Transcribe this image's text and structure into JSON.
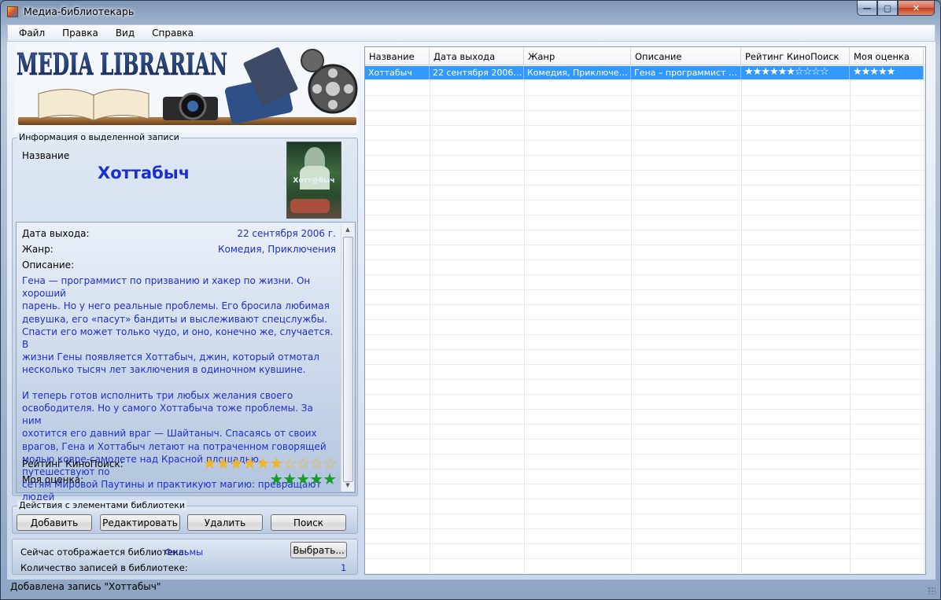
{
  "window": {
    "title": "Медиа-библиотекарь"
  },
  "menu": [
    "Файл",
    "Правка",
    "Вид",
    "Справка"
  ],
  "banner": {
    "text": "MEDIA LIBRARIAN"
  },
  "info": {
    "group_title": "Информация о выделенной записи",
    "name_label": "Название",
    "title": "Хоттабыч",
    "poster_text": "Хотт@быч",
    "release_label": "Дата выхода:",
    "release_value": "22 сентября 2006 г.",
    "genre_label": "Жанр:",
    "genre_value": "Комедия, Приключения",
    "desc_label": "Описание:",
    "description": "Гена — программист по призванию и хакер по жизни. Он хороший\nпарень. Но у него реальные проблемы. Его бросила любимая\nдевушка, его «пасут» бандиты и выслеживают спецслужбы.\nСпасти его может только чудо, и оно, конечно же, случается. В\nжизни Гены появляется Хоттабыч, джин, который отмотал\nнесколько тысяч лет заключения в одиночном кувшине.\n\nИ теперь готов исполнить три любых желания своего\nосвободителя. Но у самого Хоттабыча тоже проблемы. За ним\nохотится его давний враг — Шайтаныч. Спасаясь от своих\nврагов, Гена и Хоттабыч летают на потраченном говорящей\nмолью ковре-самолете над Красной площадью, путешествуют по\nсетям Мировой Паутины и практикуют магию: превращают людей\nв вещи, а вещи в людей...",
    "kp_rating_label": "Рейтинг КиноПоиск:",
    "kp_rating": 6,
    "kp_rating_max": 10,
    "my_rating_label": "Моя оценка:",
    "my_rating": 5,
    "my_rating_max": 5
  },
  "actions": {
    "group_title": "Действия с элементами библиотеки",
    "add": "Добавить",
    "edit": "Редактировать",
    "delete": "Удалить",
    "search": "Поиск"
  },
  "library": {
    "current_label": "Сейчас отображается библиотека:",
    "current_value": "Фильмы",
    "choose": "Выбрать...",
    "count_label": "Количество записей в библиотеке:",
    "count_value": "1"
  },
  "grid": {
    "columns": [
      "Название",
      "Дата выхода",
      "Жанр",
      "Описание",
      "Рейтинг КиноПоиск",
      "Моя оценка"
    ],
    "rows": [
      [
        "Хоттабыч",
        "22 сентября 2006 г.",
        "Комедия, Приключения",
        "Гена – программист по...",
        "★★★★★★☆☆☆☆",
        "★★★★★"
      ]
    ]
  },
  "status": "Добавлена запись \"Хоттабыч\"",
  "colors": {
    "accent_text": "#1b2fd0",
    "selection": "#3399ff",
    "star_gold": "#f3b422",
    "star_green": "#1a9a2a"
  }
}
